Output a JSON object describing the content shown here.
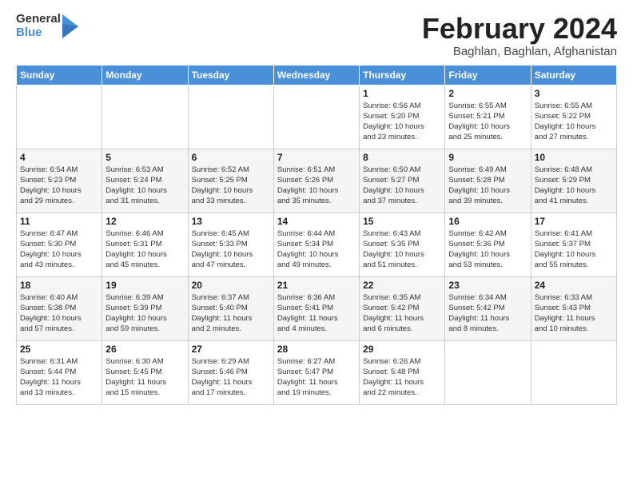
{
  "logo": {
    "line1": "General",
    "line2": "Blue"
  },
  "title": "February 2024",
  "subtitle": "Baghlan, Baghlan, Afghanistan",
  "headers": [
    "Sunday",
    "Monday",
    "Tuesday",
    "Wednesday",
    "Thursday",
    "Friday",
    "Saturday"
  ],
  "weeks": [
    [
      {
        "day": "",
        "info": ""
      },
      {
        "day": "",
        "info": ""
      },
      {
        "day": "",
        "info": ""
      },
      {
        "day": "",
        "info": ""
      },
      {
        "day": "1",
        "info": "Sunrise: 6:56 AM\nSunset: 5:20 PM\nDaylight: 10 hours\nand 23 minutes."
      },
      {
        "day": "2",
        "info": "Sunrise: 6:55 AM\nSunset: 5:21 PM\nDaylight: 10 hours\nand 25 minutes."
      },
      {
        "day": "3",
        "info": "Sunrise: 6:55 AM\nSunset: 5:22 PM\nDaylight: 10 hours\nand 27 minutes."
      }
    ],
    [
      {
        "day": "4",
        "info": "Sunrise: 6:54 AM\nSunset: 5:23 PM\nDaylight: 10 hours\nand 29 minutes."
      },
      {
        "day": "5",
        "info": "Sunrise: 6:53 AM\nSunset: 5:24 PM\nDaylight: 10 hours\nand 31 minutes."
      },
      {
        "day": "6",
        "info": "Sunrise: 6:52 AM\nSunset: 5:25 PM\nDaylight: 10 hours\nand 33 minutes."
      },
      {
        "day": "7",
        "info": "Sunrise: 6:51 AM\nSunset: 5:26 PM\nDaylight: 10 hours\nand 35 minutes."
      },
      {
        "day": "8",
        "info": "Sunrise: 6:50 AM\nSunset: 5:27 PM\nDaylight: 10 hours\nand 37 minutes."
      },
      {
        "day": "9",
        "info": "Sunrise: 6:49 AM\nSunset: 5:28 PM\nDaylight: 10 hours\nand 39 minutes."
      },
      {
        "day": "10",
        "info": "Sunrise: 6:48 AM\nSunset: 5:29 PM\nDaylight: 10 hours\nand 41 minutes."
      }
    ],
    [
      {
        "day": "11",
        "info": "Sunrise: 6:47 AM\nSunset: 5:30 PM\nDaylight: 10 hours\nand 43 minutes."
      },
      {
        "day": "12",
        "info": "Sunrise: 6:46 AM\nSunset: 5:31 PM\nDaylight: 10 hours\nand 45 minutes."
      },
      {
        "day": "13",
        "info": "Sunrise: 6:45 AM\nSunset: 5:33 PM\nDaylight: 10 hours\nand 47 minutes."
      },
      {
        "day": "14",
        "info": "Sunrise: 6:44 AM\nSunset: 5:34 PM\nDaylight: 10 hours\nand 49 minutes."
      },
      {
        "day": "15",
        "info": "Sunrise: 6:43 AM\nSunset: 5:35 PM\nDaylight: 10 hours\nand 51 minutes."
      },
      {
        "day": "16",
        "info": "Sunrise: 6:42 AM\nSunset: 5:36 PM\nDaylight: 10 hours\nand 53 minutes."
      },
      {
        "day": "17",
        "info": "Sunrise: 6:41 AM\nSunset: 5:37 PM\nDaylight: 10 hours\nand 55 minutes."
      }
    ],
    [
      {
        "day": "18",
        "info": "Sunrise: 6:40 AM\nSunset: 5:38 PM\nDaylight: 10 hours\nand 57 minutes."
      },
      {
        "day": "19",
        "info": "Sunrise: 6:39 AM\nSunset: 5:39 PM\nDaylight: 10 hours\nand 59 minutes."
      },
      {
        "day": "20",
        "info": "Sunrise: 6:37 AM\nSunset: 5:40 PM\nDaylight: 11 hours\nand 2 minutes."
      },
      {
        "day": "21",
        "info": "Sunrise: 6:36 AM\nSunset: 5:41 PM\nDaylight: 11 hours\nand 4 minutes."
      },
      {
        "day": "22",
        "info": "Sunrise: 6:35 AM\nSunset: 5:42 PM\nDaylight: 11 hours\nand 6 minutes."
      },
      {
        "day": "23",
        "info": "Sunrise: 6:34 AM\nSunset: 5:42 PM\nDaylight: 11 hours\nand 8 minutes."
      },
      {
        "day": "24",
        "info": "Sunrise: 6:33 AM\nSunset: 5:43 PM\nDaylight: 11 hours\nand 10 minutes."
      }
    ],
    [
      {
        "day": "25",
        "info": "Sunrise: 6:31 AM\nSunset: 5:44 PM\nDaylight: 11 hours\nand 13 minutes."
      },
      {
        "day": "26",
        "info": "Sunrise: 6:30 AM\nSunset: 5:45 PM\nDaylight: 11 hours\nand 15 minutes."
      },
      {
        "day": "27",
        "info": "Sunrise: 6:29 AM\nSunset: 5:46 PM\nDaylight: 11 hours\nand 17 minutes."
      },
      {
        "day": "28",
        "info": "Sunrise: 6:27 AM\nSunset: 5:47 PM\nDaylight: 11 hours\nand 19 minutes."
      },
      {
        "day": "29",
        "info": "Sunrise: 6:26 AM\nSunset: 5:48 PM\nDaylight: 11 hours\nand 22 minutes."
      },
      {
        "day": "",
        "info": ""
      },
      {
        "day": "",
        "info": ""
      }
    ]
  ]
}
